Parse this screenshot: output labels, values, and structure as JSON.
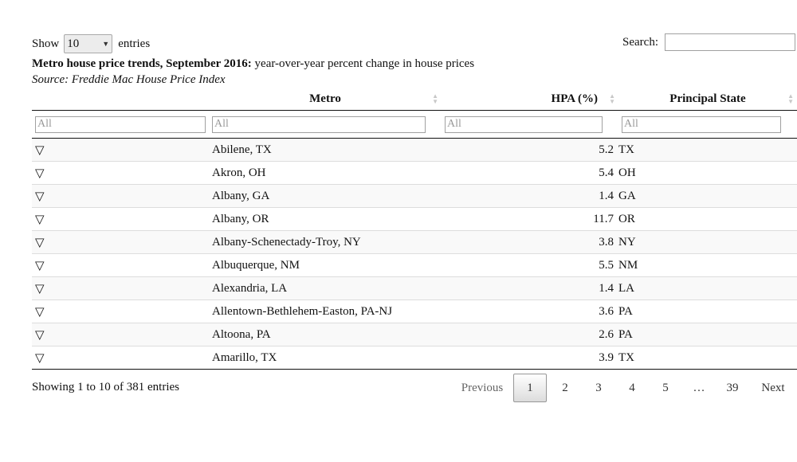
{
  "length": {
    "show_label": "Show",
    "value": "10",
    "entries_label": "entries"
  },
  "search": {
    "label": "Search:",
    "value": ""
  },
  "caption": {
    "title": "Metro house price trends, September 2016:",
    "subtitle": " year-over-year percent change in house prices",
    "source": "Source: Freddie Mac House Price Index"
  },
  "columns": {
    "metro": "Metro",
    "hpa": "HPA (%)",
    "state": "Principal State"
  },
  "filters": {
    "placeholder": "All"
  },
  "rows": [
    {
      "icon": "▽",
      "metro": "Abilene, TX",
      "hpa": "5.2",
      "state": "TX"
    },
    {
      "icon": "▽",
      "metro": "Akron, OH",
      "hpa": "5.4",
      "state": "OH"
    },
    {
      "icon": "▽",
      "metro": "Albany, GA",
      "hpa": "1.4",
      "state": "GA"
    },
    {
      "icon": "▽",
      "metro": "Albany, OR",
      "hpa": "11.7",
      "state": "OR"
    },
    {
      "icon": "▽",
      "metro": "Albany-Schenectady-Troy, NY",
      "hpa": "3.8",
      "state": "NY"
    },
    {
      "icon": "▽",
      "metro": "Albuquerque, NM",
      "hpa": "5.5",
      "state": "NM"
    },
    {
      "icon": "▽",
      "metro": "Alexandria, LA",
      "hpa": "1.4",
      "state": "LA"
    },
    {
      "icon": "▽",
      "metro": "Allentown-Bethlehem-Easton, PA-NJ",
      "hpa": "3.6",
      "state": "PA"
    },
    {
      "icon": "▽",
      "metro": "Altoona, PA",
      "hpa": "2.6",
      "state": "PA"
    },
    {
      "icon": "▽",
      "metro": "Amarillo, TX",
      "hpa": "3.9",
      "state": "TX"
    }
  ],
  "info": "Showing 1 to 10 of 381 entries",
  "pager": {
    "previous": "Previous",
    "pages": [
      "1",
      "2",
      "3",
      "4",
      "5",
      "…",
      "39"
    ],
    "next": "Next"
  }
}
